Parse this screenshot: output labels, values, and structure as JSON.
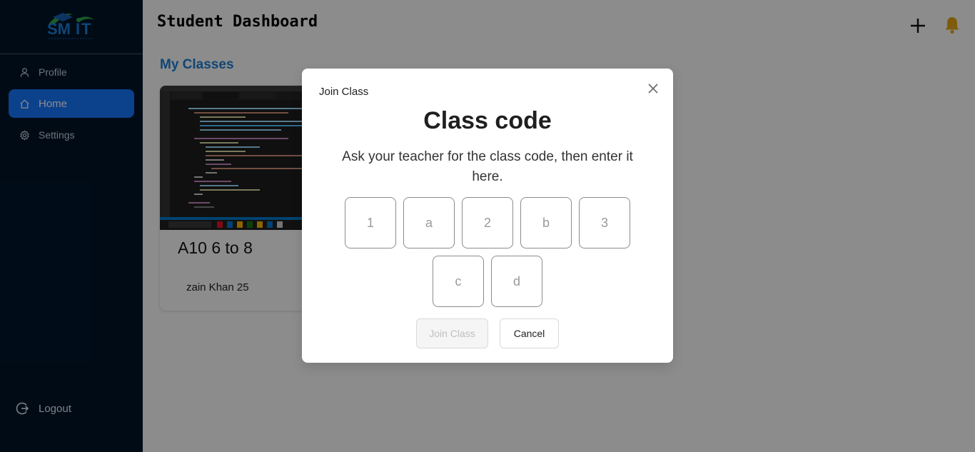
{
  "sidebar": {
    "logo_text": "SMIT",
    "items": [
      {
        "label": "Profile",
        "icon": "user-icon"
      },
      {
        "label": "Home",
        "icon": "home-icon"
      },
      {
        "label": "Settings",
        "icon": "gear-icon"
      }
    ],
    "logout_label": "Logout"
  },
  "header": {
    "title": "Student Dashboard"
  },
  "main": {
    "section_title": "My Classes",
    "classes": [
      {
        "title": "A10 6 to 8",
        "teacher": "zain Khan 25"
      }
    ]
  },
  "modal": {
    "header": "Join Class",
    "heading": "Class code",
    "description": "Ask your teacher for the class code, then enter it here.",
    "code": [
      "1",
      "a",
      "2",
      "b",
      "3",
      "c",
      "d"
    ],
    "join_label": "Join Class",
    "cancel_label": "Cancel"
  },
  "colors": {
    "sidebar_bg": "#001529",
    "active_item": "#1677ff",
    "section_title": "#1e7fd6",
    "bell": "#e6a817"
  }
}
